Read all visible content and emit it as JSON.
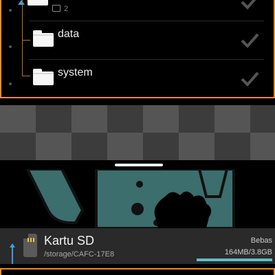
{
  "tree": {
    "parent_subfolder_count": "2",
    "items": [
      {
        "name": "data"
      },
      {
        "name": "system"
      }
    ]
  },
  "storage": {
    "title": "Kartu SD",
    "path": "/storage/CAFC-17E8",
    "free_label": "Bebas",
    "usage": "164MB/3.8GB",
    "usage_fraction": 0.04
  },
  "colors": {
    "accent_orange": "#f28c1e",
    "progress": "#5bbfc7",
    "nav_arrow": "#3aa0e6"
  }
}
